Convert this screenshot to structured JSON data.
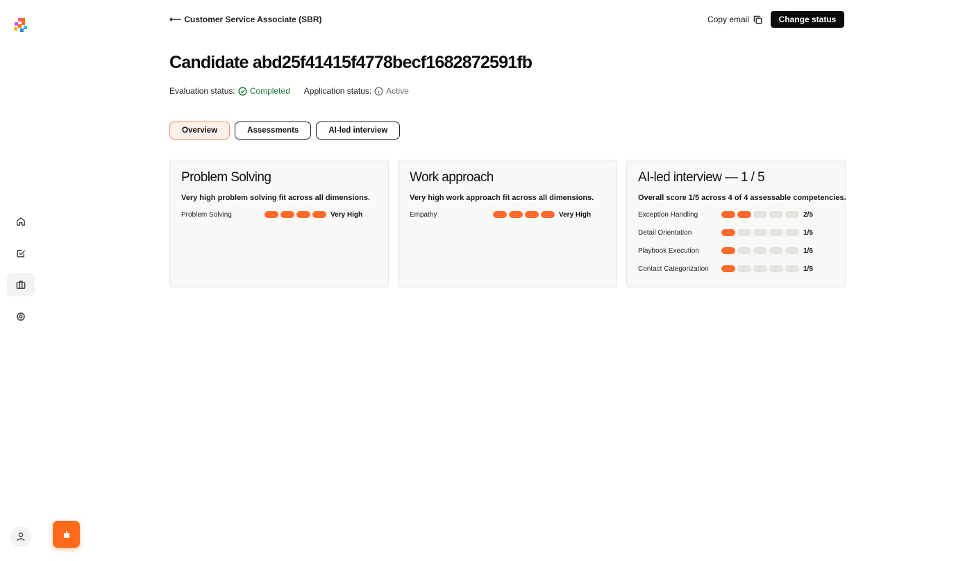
{
  "sidebar": {
    "items": [
      {
        "name": "home",
        "icon": "home-icon"
      },
      {
        "name": "tasks",
        "icon": "checkbox-icon"
      },
      {
        "name": "jobs",
        "icon": "briefcase-icon",
        "active": true
      },
      {
        "name": "settings",
        "icon": "gear-icon"
      }
    ],
    "profile_icon": "user-icon"
  },
  "header": {
    "back_label": "Customer Service Associate (SBR)",
    "copy_email_label": "Copy email",
    "change_status_label": "Change status"
  },
  "candidate": {
    "title": "Candidate abd25f41415f4778becf1682872591fb",
    "evaluation_status_label": "Evaluation status:",
    "evaluation_status": "Completed",
    "application_status_label": "Application status:",
    "application_status": "Active"
  },
  "tabs": [
    {
      "label": "Overview",
      "active": true
    },
    {
      "label": "Assessments",
      "active": false
    },
    {
      "label": "AI-led interview",
      "active": false
    }
  ],
  "cards": [
    {
      "title": "Problem Solving",
      "description": "Very high problem solving fit across all dimensions.",
      "rows": [
        {
          "label": "Problem Solving",
          "filled": 4,
          "total": 4,
          "score": "Very High"
        }
      ]
    },
    {
      "title": "Work approach",
      "description": "Very high work approach fit across all dimensions.",
      "rows": [
        {
          "label": "Empathy",
          "filled": 4,
          "total": 4,
          "score": "Very High"
        }
      ]
    },
    {
      "title": "AI-led interview — 1 / 5",
      "description": "Overall score 1/5 across 4 of 4 assessable competencies.",
      "rows": [
        {
          "label": "Exception Handling",
          "filled": 2,
          "total": 5,
          "score": "2/5"
        },
        {
          "label": "Detail Orientation",
          "filled": 1,
          "total": 5,
          "score": "1/5"
        },
        {
          "label": "Playbook Execution",
          "filled": 1,
          "total": 5,
          "score": "1/5"
        },
        {
          "label": "Contact Categorization",
          "filled": 1,
          "total": 5,
          "score": "1/5"
        }
      ]
    }
  ],
  "colors": {
    "accent": "#ff6a2b",
    "success": "#1f7a33",
    "pill_empty": "#e3e3e0"
  }
}
